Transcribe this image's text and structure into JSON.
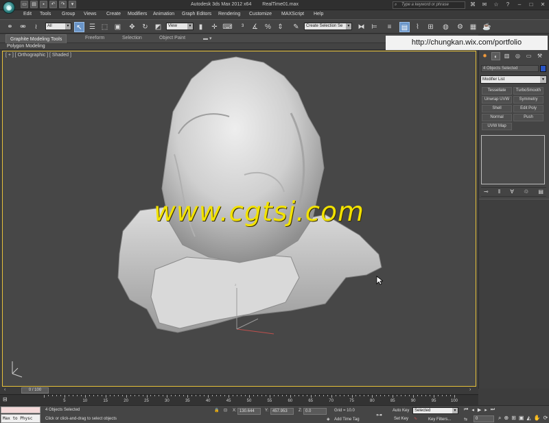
{
  "titlebar": {
    "app_title": "Autodesk 3ds Max  2012 x64",
    "file_name": "RealTime01.max",
    "search_placeholder": "Type a keyword or phrase"
  },
  "menu": [
    "Edit",
    "Tools",
    "Group",
    "Views",
    "Create",
    "Modifiers",
    "Animation",
    "Graph Editors",
    "Rendering",
    "Customize",
    "MAXScript",
    "Help"
  ],
  "toolbar": {
    "filter_value": "All",
    "coord_system": "View",
    "selection_set_placeholder": "Create Selection Se"
  },
  "ribbon": {
    "tabs": [
      "Graphite Modeling Tools",
      "Freeform",
      "Selection",
      "Object Paint"
    ],
    "active_tab": "Graphite Modeling Tools",
    "sub_label": "Polygon Modeling"
  },
  "overlay": {
    "url": "http://chungkan.wix.com/portfolio",
    "watermark": "www.cgtsj.com"
  },
  "viewport": {
    "label": "[ + ] [ Orthographic ] [ Shaded ]"
  },
  "command_panel": {
    "selection_name": "4 Objects Selected",
    "modifier_list_label": "Modifier List",
    "modifier_buttons": [
      "Tessellate",
      "TurboSmooth",
      "Unwrap UVW",
      "Symmetry",
      "Shell",
      "Edit Poly",
      "Normal",
      "Push",
      "UVW Map"
    ],
    "object_color": "#2a55c4"
  },
  "timeline": {
    "current_frame_label": "0 / 100",
    "ticks": [
      "0",
      "5",
      "10",
      "15",
      "20",
      "25",
      "30",
      "35",
      "40",
      "45",
      "50",
      "55",
      "60",
      "65",
      "70",
      "75",
      "80",
      "85",
      "90",
      "95",
      "100"
    ]
  },
  "statusbar": {
    "maxscript_text": "Max to Physc",
    "selection_status": "4 Objects Selected",
    "prompt": "Click or click-and-drag to select objects",
    "x_label": "X:",
    "x_value": "130.644",
    "y_label": "Y:",
    "y_value": "457.953",
    "z_label": "Z:",
    "z_value": "0.0",
    "grid": "Grid = 10.0",
    "add_time_tag": "Add Time Tag",
    "auto_key": "Auto Key",
    "set_key": "Set Key",
    "key_mode_value": "Selected",
    "key_filters": "Key Filters...",
    "frame_value": "0"
  },
  "colors": {
    "viewport_border": "#e8c23a",
    "watermark": "#f2e200",
    "active_button": "#6a95c8"
  }
}
